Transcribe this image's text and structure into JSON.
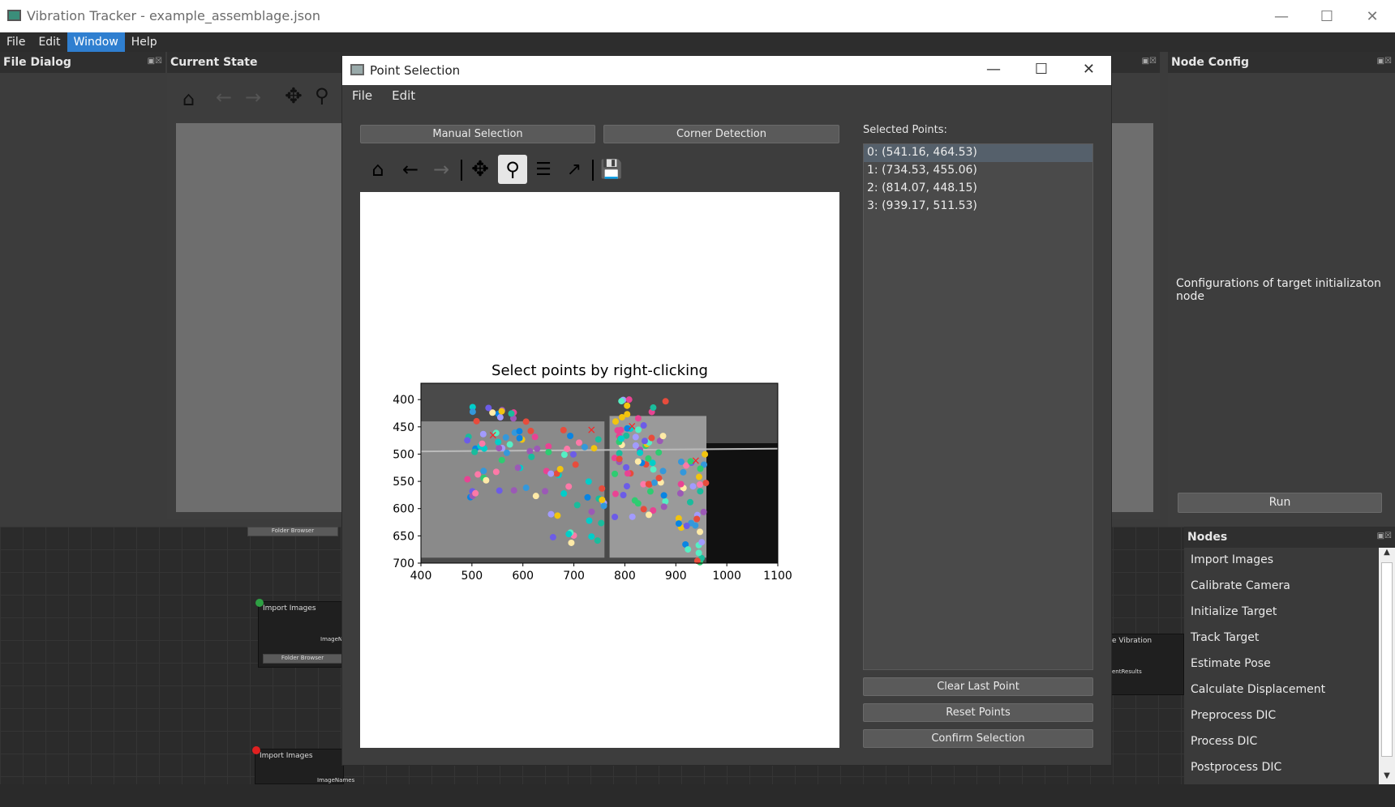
{
  "window": {
    "title": "Vibration Tracker - example_assemblage.json"
  },
  "menubar": {
    "items": [
      "File",
      "Edit",
      "Window",
      "Help"
    ],
    "active": "Window"
  },
  "docks": {
    "file_dialog": "File Dialog",
    "current_state": "Current State",
    "node_config": "Node Config",
    "nodes": "Nodes"
  },
  "node_config": {
    "description": "Configurations of target initializaton node",
    "run_label": "Run"
  },
  "nodes_list": [
    "Import Images",
    "Calibrate Camera",
    "Initialize Target",
    "Track Target",
    "Estimate Pose",
    "Calculate Displacement",
    "Preprocess DIC",
    "Process DIC",
    "Postprocess DIC"
  ],
  "graph": {
    "node1_title": "Import Images",
    "node1_output": "ImageN",
    "node1_button": "Folder Browser",
    "top_button": "Folder Browser",
    "node2_title": "Import Images",
    "node2_output": "ImageNames",
    "right_node_title": "e Vibration",
    "right_node_output": "entResults"
  },
  "dialog": {
    "title": "Point Selection",
    "menu": [
      "File",
      "Edit"
    ],
    "manual_selection": "Manual Selection",
    "corner_detection": "Corner Detection",
    "selected_points_label": "Selected Points:",
    "points": [
      "0: (541.16, 464.53)",
      "1: (734.53, 455.06)",
      "2: (814.07, 448.15)",
      "3: (939.17, 511.53)"
    ],
    "clear_last": "Clear Last Point",
    "reset_points": "Reset Points",
    "confirm_selection": "Confirm Selection"
  },
  "chart_data": {
    "type": "scatter",
    "title": "Select points by right-clicking",
    "xlim": [
      400,
      1100
    ],
    "ylim": [
      700,
      370
    ],
    "xticks": [
      "400",
      "500",
      "600",
      "700",
      "800",
      "900",
      "1000",
      "1100"
    ],
    "yticks": [
      "400",
      "450",
      "500",
      "550",
      "600",
      "650",
      "700"
    ],
    "selected_markers": [
      [
        541.16,
        464.53
      ],
      [
        734.53,
        455.06
      ],
      [
        814.07,
        448.15
      ],
      [
        939.17,
        511.53
      ]
    ]
  }
}
